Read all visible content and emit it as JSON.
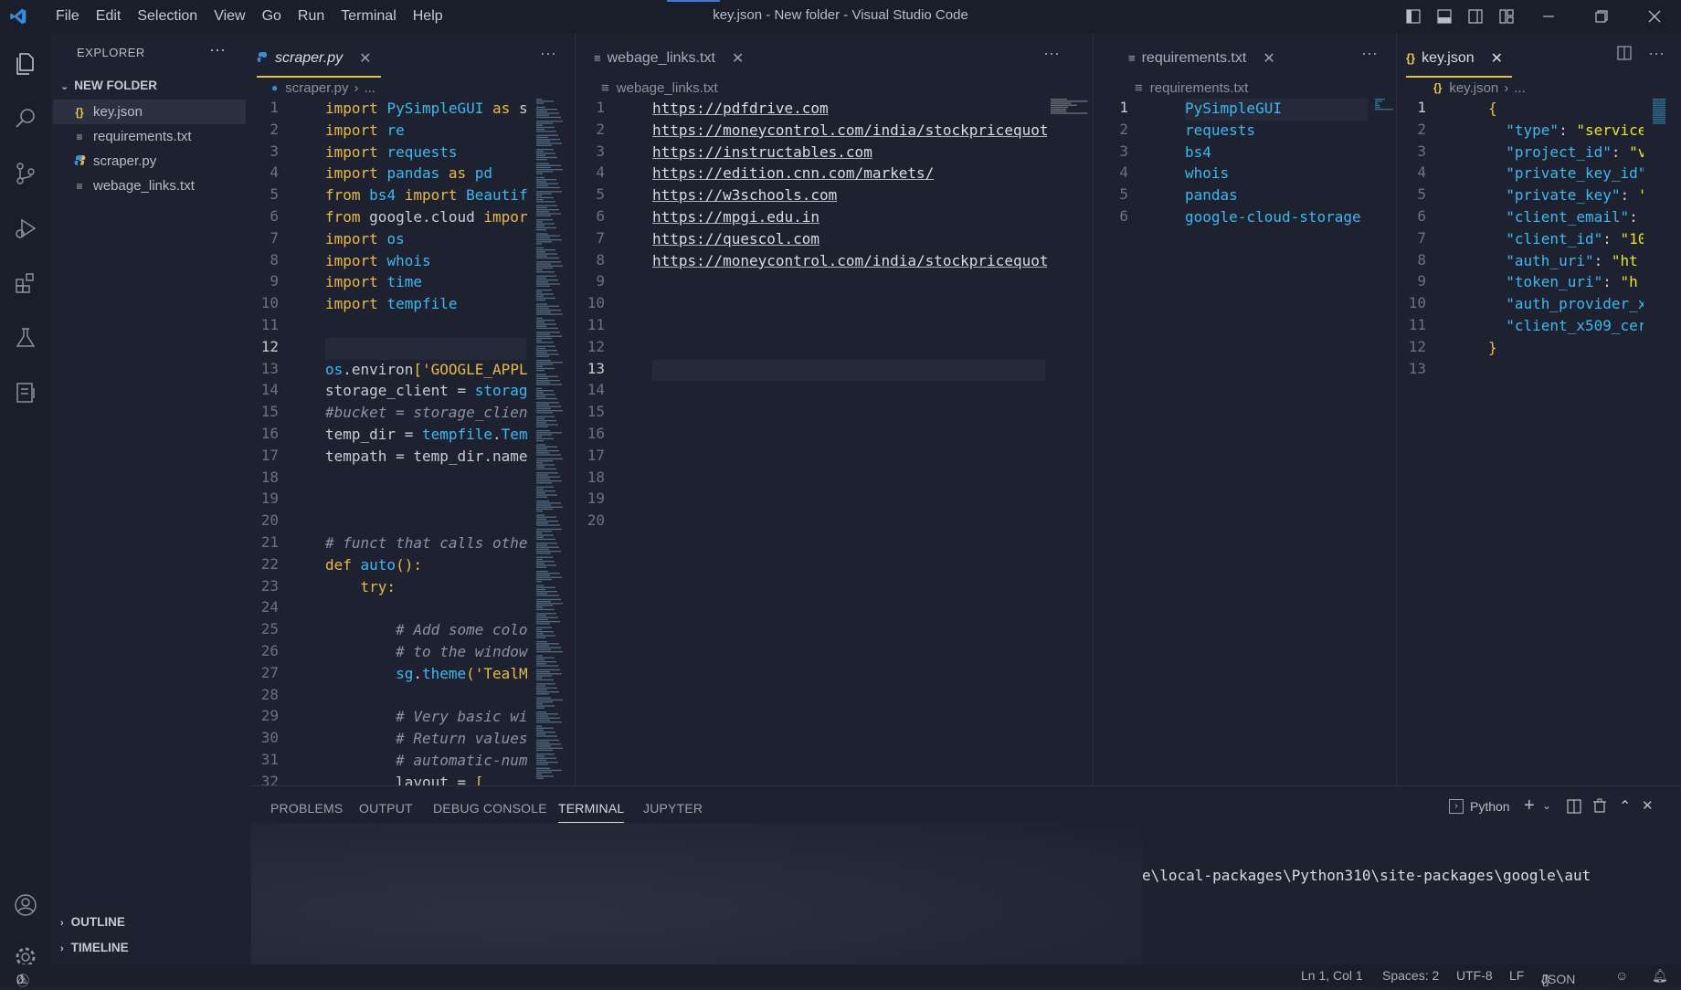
{
  "window": {
    "title": "key.json - New folder - Visual Studio Code",
    "menu": [
      "File",
      "Edit",
      "Selection",
      "View",
      "Go",
      "Run",
      "Terminal",
      "Help"
    ]
  },
  "sidebar": {
    "header": "EXPLORER",
    "more": "···",
    "folder": "NEW FOLDER",
    "files": [
      {
        "name": "key.json",
        "icon": "{}",
        "icon_color": "#e9c84a"
      },
      {
        "name": "requirements.txt",
        "icon": "≡",
        "icon_color": "#b0b4be"
      },
      {
        "name": "scraper.py",
        "icon": "py",
        "icon_color": "#3b8fd1"
      },
      {
        "name": "webage_links.txt",
        "icon": "≡",
        "icon_color": "#b0b4be"
      }
    ],
    "outline": "OUTLINE",
    "timeline": "TIMELINE"
  },
  "group1": {
    "tab": "scraper.py",
    "breadcrumb": "scraper.py",
    "breadcrumb_more": "...",
    "current_line": 12,
    "line_count": 32,
    "lines": [
      [
        [
          "kw",
          "import "
        ],
        [
          "fn",
          "PySimpleGUI "
        ],
        [
          "kw",
          "as "
        ],
        [
          "",
          "s"
        ]
      ],
      [
        [
          "kw",
          "import "
        ],
        [
          "fn",
          "re"
        ]
      ],
      [
        [
          "kw",
          "import "
        ],
        [
          "fn",
          "requests"
        ]
      ],
      [
        [
          "kw",
          "import "
        ],
        [
          "fn",
          "pandas "
        ],
        [
          "kw",
          "as "
        ],
        [
          "fn",
          "pd"
        ]
      ],
      [
        [
          "kw",
          "from "
        ],
        [
          "fn",
          "bs4 "
        ],
        [
          "kw",
          "import "
        ],
        [
          "fn",
          "Beautif"
        ]
      ],
      [
        [
          "kw",
          "from "
        ],
        [
          "",
          "google.cloud "
        ],
        [
          "kw",
          "impor"
        ]
      ],
      [
        [
          "kw",
          "import "
        ],
        [
          "fn",
          "os"
        ]
      ],
      [
        [
          "kw",
          "import "
        ],
        [
          "fn",
          "whois"
        ]
      ],
      [
        [
          "kw",
          "import "
        ],
        [
          "fn",
          "time"
        ]
      ],
      [
        [
          "kw",
          "import "
        ],
        [
          "fn",
          "tempfile"
        ]
      ],
      [],
      [],
      [
        [
          "fn",
          "os"
        ],
        [
          "",
          "."
        ],
        [
          "",
          "environ"
        ],
        [
          "kw",
          "["
        ],
        [
          "str",
          "'GOOGLE_APPL"
        ]
      ],
      [
        [
          "",
          "storage_client = "
        ],
        [
          "fn",
          "storag"
        ]
      ],
      [
        [
          "cm",
          "#bucket = storage_clien"
        ]
      ],
      [
        [
          "",
          "temp_dir = "
        ],
        [
          "fn",
          "tempfile"
        ],
        [
          "",
          "."
        ],
        [
          "fn",
          "Tem"
        ]
      ],
      [
        [
          "",
          "tempath = temp_dir.name"
        ]
      ],
      [],
      [],
      [],
      [
        [
          "cm",
          "# funct that calls othe"
        ]
      ],
      [
        [
          "kw",
          "def "
        ],
        [
          "fn",
          "auto"
        ],
        [
          "kw",
          "():"
        ]
      ],
      [
        [
          "",
          "    "
        ],
        [
          "kw",
          "try:"
        ]
      ],
      [],
      [
        [
          "",
          "        "
        ],
        [
          "cm",
          "# Add some colo"
        ]
      ],
      [
        [
          "",
          "        "
        ],
        [
          "cm",
          "# to the window"
        ]
      ],
      [
        [
          "",
          "        "
        ],
        [
          "fn",
          "sg"
        ],
        [
          "",
          "."
        ],
        [
          "fn",
          "theme"
        ],
        [
          "kw",
          "("
        ],
        [
          "str",
          "'TealM"
        ]
      ],
      [],
      [
        [
          "",
          "        "
        ],
        [
          "cm",
          "# Very basic wi"
        ]
      ],
      [
        [
          "",
          "        "
        ],
        [
          "cm",
          "# Return values"
        ]
      ],
      [
        [
          "",
          "        "
        ],
        [
          "cm",
          "# automatic-num"
        ]
      ],
      [
        [
          "",
          "        "
        ],
        [
          "",
          "layout = "
        ],
        [
          "kw",
          "["
        ]
      ]
    ]
  },
  "group2": {
    "tab": "webage_links.txt",
    "breadcrumb": "webage_links.txt",
    "current_line": 13,
    "line_count": 20,
    "lines": [
      "https://pdfdrive.com",
      "https://moneycontrol.com/india/stockpricequot",
      "https://instructables.com",
      "https://edition.cnn.com/markets/",
      "https://w3schools.com",
      "https://mpgi.edu.in",
      "https://quescol.com",
      "https://moneycontrol.com/india/stockpricequot"
    ]
  },
  "group3": {
    "tab": "requirements.txt",
    "breadcrumb": "requirements.txt",
    "current_line": 1,
    "line_count": 6,
    "lines": [
      "PySimpleGUI",
      "requests",
      "bs4",
      "whois",
      "pandas",
      "google-cloud-storage"
    ]
  },
  "group4": {
    "tab": "key.json",
    "breadcrumb": "key.json",
    "breadcrumb_more": "...",
    "current_line": 1,
    "line_count": 13,
    "lines": [
      [
        [
          "br",
          "{"
        ]
      ],
      [
        [
          "key",
          "  \"type\""
        ],
        [
          "p",
          ": "
        ],
        [
          "val",
          "\"service"
        ]
      ],
      [
        [
          "key",
          "  \"project_id\""
        ],
        [
          "p",
          ": "
        ],
        [
          "val",
          "\"v"
        ]
      ],
      [
        [
          "key",
          "  \"private_key_id\""
        ]
      ],
      [
        [
          "key",
          "  \"private_key\""
        ],
        [
          "p",
          ": "
        ],
        [
          "val",
          "'"
        ]
      ],
      [
        [
          "key",
          "  \"client_email\""
        ],
        [
          "p",
          ":"
        ]
      ],
      [
        [
          "key",
          "  \"client_id\""
        ],
        [
          "p",
          ": "
        ],
        [
          "val",
          "\"10"
        ]
      ],
      [
        [
          "key",
          "  \"auth_uri\""
        ],
        [
          "p",
          ": "
        ],
        [
          "val",
          "\"ht"
        ]
      ],
      [
        [
          "key",
          "  \"token_uri\""
        ],
        [
          "p",
          ": "
        ],
        [
          "val",
          "\"h"
        ]
      ],
      [
        [
          "key",
          "  \"auth_provider_x"
        ]
      ],
      [
        [
          "key",
          "  \"client_x509_cer"
        ]
      ],
      [
        [
          "br",
          "}"
        ]
      ],
      []
    ]
  },
  "panel": {
    "tabs": [
      "PROBLEMS",
      "OUTPUT",
      "DEBUG CONSOLE",
      "TERMINAL",
      "JUPYTER"
    ],
    "active_tab": "TERMINAL",
    "terminal_name": "Python",
    "terminal_text": "e\\local-packages\\Python310\\site-packages\\google\\aut"
  },
  "status": {
    "errors": "0",
    "warnings": "0",
    "cursor": "Ln 1, Col 1",
    "spaces": "Spaces: 2",
    "encoding": "UTF-8",
    "eol": "LF",
    "language": "JSON",
    "language_icon": "{}"
  },
  "colors": {
    "accent": "#e2c04a",
    "keyword": "#e9b949",
    "function": "#3fb8f0",
    "json_key": "#3fb8f0",
    "json_value": "#e6e22e"
  }
}
